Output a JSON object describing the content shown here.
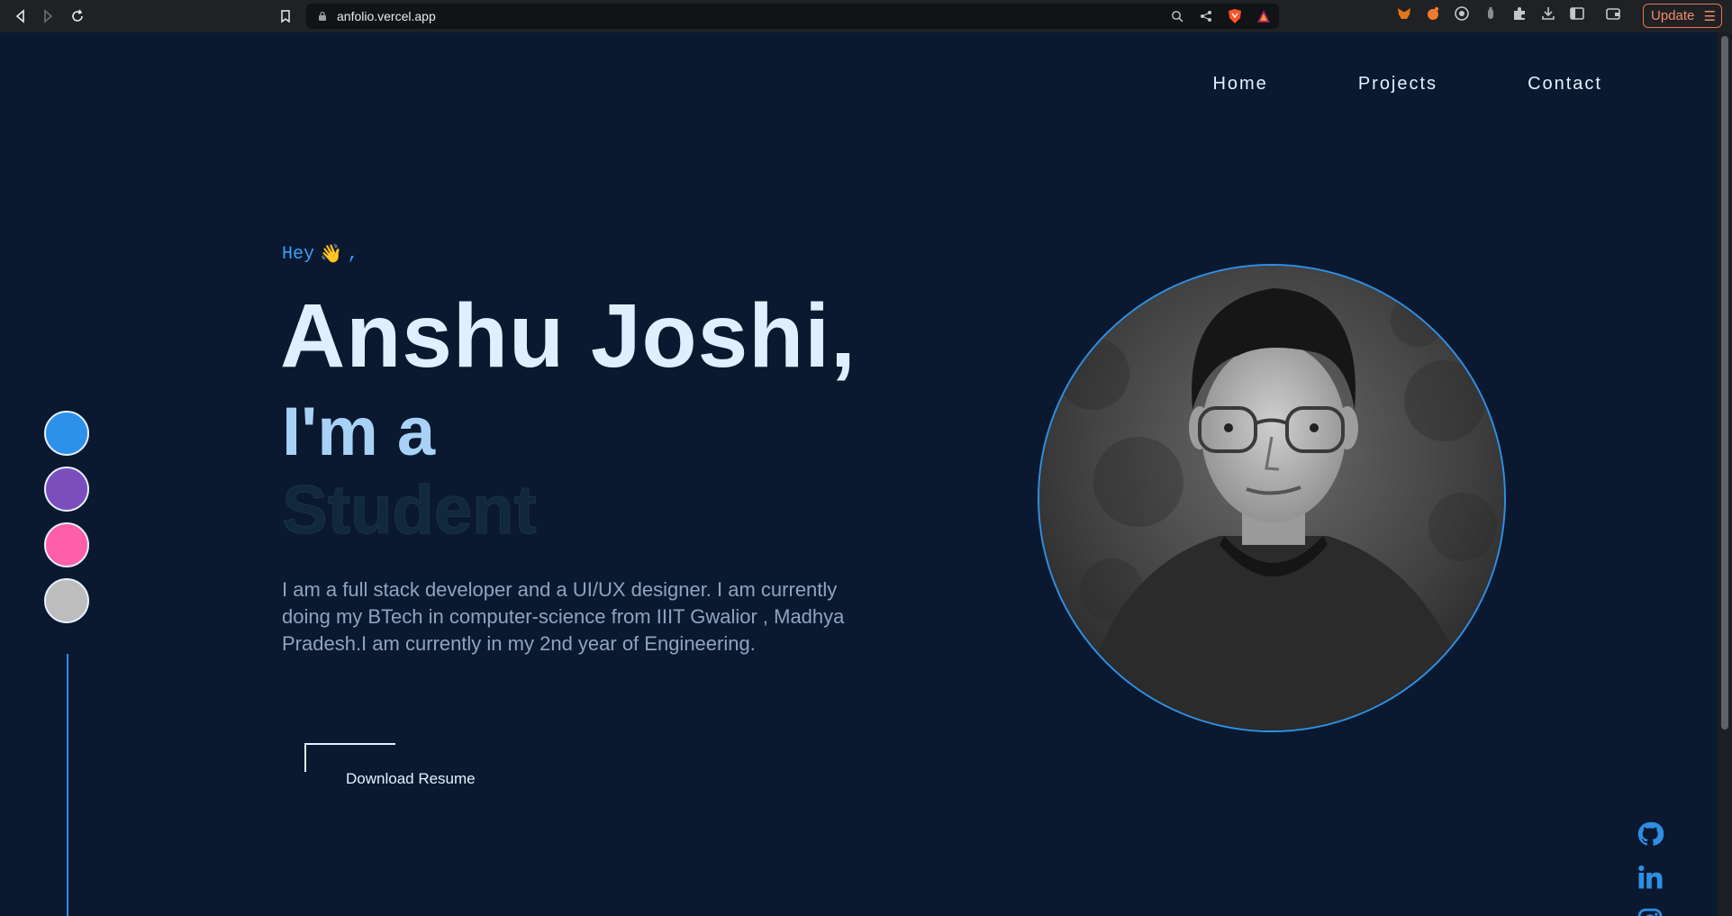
{
  "browser": {
    "url": "anfolio.vercel.app",
    "update_label": "Update",
    "icons": [
      "back-icon",
      "forward-icon",
      "reload-icon",
      "bookmark-icon",
      "lock-icon",
      "zoom-icon",
      "share-icon",
      "brave-shield-icon",
      "brave-rewards-icon",
      "metamask-icon",
      "extension-icon",
      "extensions-puzzle-icon",
      "downloads-icon",
      "sidebar-icon",
      "wallet-icon",
      "menu-icon"
    ]
  },
  "nav": {
    "home": "Home",
    "projects": "Projects",
    "contact": "Contact"
  },
  "theme_colors": [
    "#2d91ea",
    "#7c4dbd",
    "#ff5ea8",
    "#bdbdbd"
  ],
  "hero": {
    "greeting": "Hey",
    "greeting_emoji": "👋",
    "greeting_suffix": ",",
    "name": "Anshu Joshi,",
    "intro": "I'm a",
    "role": "Student",
    "bio": "I am a full stack developer and a UI/UX designer. I am currently doing my BTech in computer-science from IIIT Gwalior , Madhya Pradesh.I am currently in my 2nd year of Engineering.",
    "download_label": "Download Resume"
  },
  "socials": [
    "github-icon",
    "linkedin-icon",
    "instagram-icon"
  ],
  "colors": {
    "background": "#0a1930",
    "accent": "#2d8fe4",
    "name_text": "#e0efff"
  }
}
